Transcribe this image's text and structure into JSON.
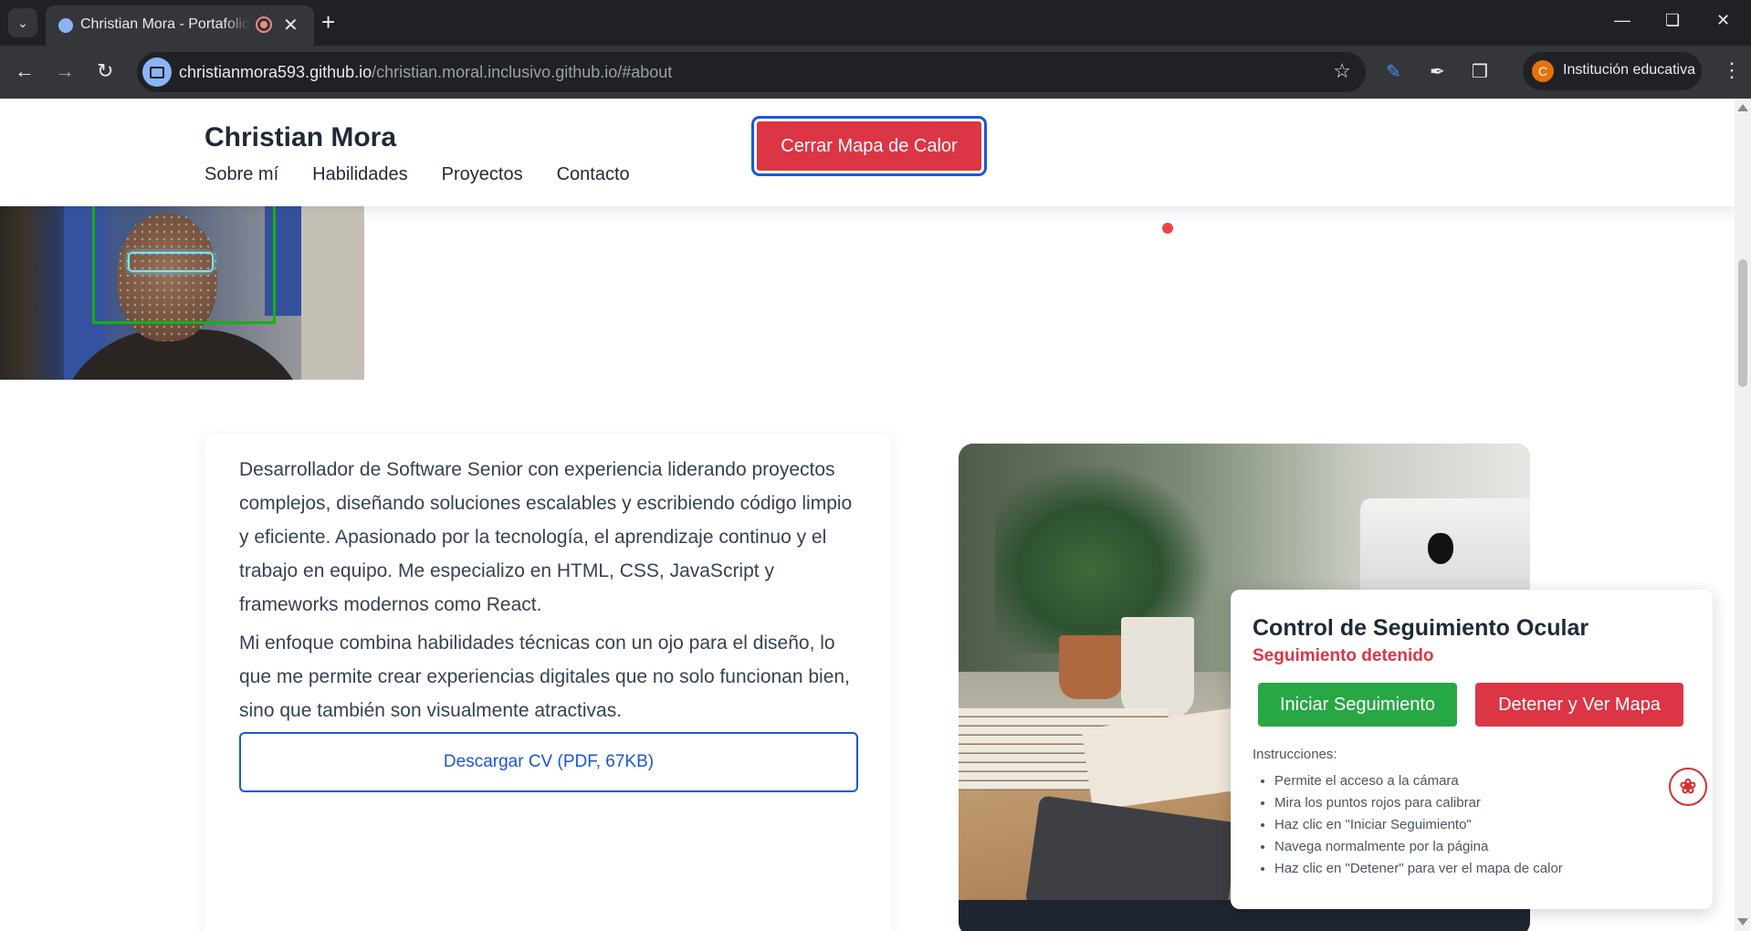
{
  "browser": {
    "tab_title": "Christian Mora - Portafolio Inclusivo",
    "url_host": "christianmora593.github.io",
    "url_path": "/christian.moral.inclusivo.github.io/#about",
    "profile_initial": "C",
    "profile_label": "Institución educativa"
  },
  "header": {
    "brand": "Christian Mora",
    "nav": [
      "Sobre mí",
      "Habilidades",
      "Proyectos",
      "Contacto"
    ],
    "heatmap_button": "Cerrar Mapa de Calor"
  },
  "about": {
    "paragraph_1": "Desarrollador de Software Senior con experiencia liderando proyectos complejos, diseñando soluciones escalables y escribiendo código limpio y eficiente. Apasionado por la tecnología, el aprendizaje continuo y el trabajo en equipo. Me especializo en HTML, CSS, JavaScript y frameworks modernos como React.",
    "paragraph_2": "Mi enfoque combina habilidades técnicas con un ojo para el diseño, lo que me permite crear experiencias digitales que no solo funcionan bien, sino que también son visualmente atractivas.",
    "cv_button": "Descargar CV (PDF, 67KB)"
  },
  "eye_tracking": {
    "title": "Control de Seguimiento Ocular",
    "status": "Seguimiento detenido",
    "start_button": "Iniciar Seguimiento",
    "stop_button": "Detener y Ver Mapa",
    "instructions_label": "Instrucciones:",
    "instructions": [
      "Permite el acceso a la cámara",
      "Mira los puntos rojos para calibrar",
      "Haz clic en \"Iniciar Seguimiento\"",
      "Navega normalmente por la página",
      "Haz clic en \"Detener\" para ver el mapa de calor"
    ]
  },
  "icons": {
    "tab_menu": "chevron-down-icon",
    "favicon": "globe-icon",
    "recording": "recording-icon",
    "back": "back-arrow-icon",
    "forward": "forward-arrow-icon",
    "reload": "reload-icon",
    "site_info": "camera-icon",
    "bookmark": "star-icon",
    "pdf": "acrobat-pdf-icon"
  },
  "colors": {
    "danger": "#dc3545",
    "success": "#28a745",
    "primary": "#1a56db"
  }
}
